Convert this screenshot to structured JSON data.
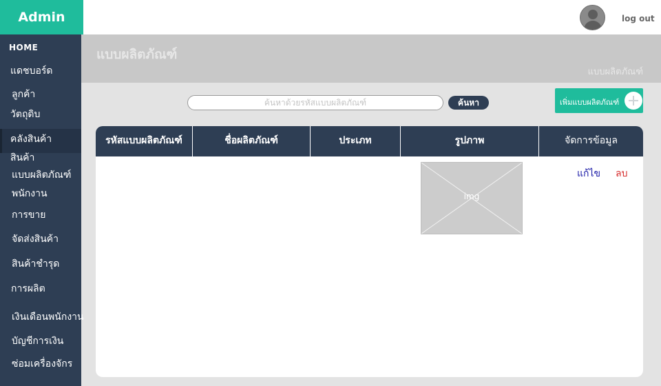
{
  "app": {
    "brand": "Admin",
    "logout_label": "log out"
  },
  "sidebar": {
    "items": [
      {
        "label": "HOME"
      },
      {
        "label": "แดชบอร์ด"
      },
      {
        "label": "ลูกค้า"
      },
      {
        "label": "วัตถุดิบ"
      },
      {
        "label": "คลังสินค้า"
      },
      {
        "label": "สินค้า"
      },
      {
        "label": "แบบผลิตภัณฑ์",
        "active": true
      },
      {
        "label": "พนักงาน"
      },
      {
        "label": "การขาย"
      },
      {
        "label": "จัดส่งสินค้า"
      },
      {
        "label": "สินค้าชำรุด"
      },
      {
        "label": "การผลิต"
      },
      {
        "label": "เงินเดือนพนักงาน"
      },
      {
        "label": "บัญชีการเงิน"
      },
      {
        "label": "ซ่อมเครื่องจักร"
      }
    ]
  },
  "page": {
    "title": "แบบผลิตภัณฑ์",
    "breadcrumb": "แบบผลิตภัณฑ์"
  },
  "search": {
    "placeholder": "ค้นหาด้วยรหัสแบบผลิตภัณฑ์",
    "value": "",
    "button_label": "ค้นหา"
  },
  "add_button": {
    "label": "เพิ่มแบบผลิตภัณฑ์"
  },
  "table": {
    "columns": [
      "รหัสแบบผลิตภัณฑ์",
      "ชื่อผลิตภัณฑ์",
      "ประเภท",
      "รูปภาพ",
      "จัดการข้อมูล"
    ],
    "rows": [
      {
        "code": "",
        "name": "",
        "type": "",
        "image_label": "img",
        "edit_label": "แก้ไข",
        "delete_label": "ลบ"
      }
    ]
  },
  "colors": {
    "accent": "#1fbc9c",
    "sidebar": "#2e3e54",
    "header_band": "#c8c8c8",
    "edit_link": "#1a1aa6",
    "delete_link": "#d62a2a"
  },
  "icons": {
    "avatar": "user-avatar-icon",
    "add": "plus-circle-icon",
    "image": "image-placeholder-icon"
  }
}
